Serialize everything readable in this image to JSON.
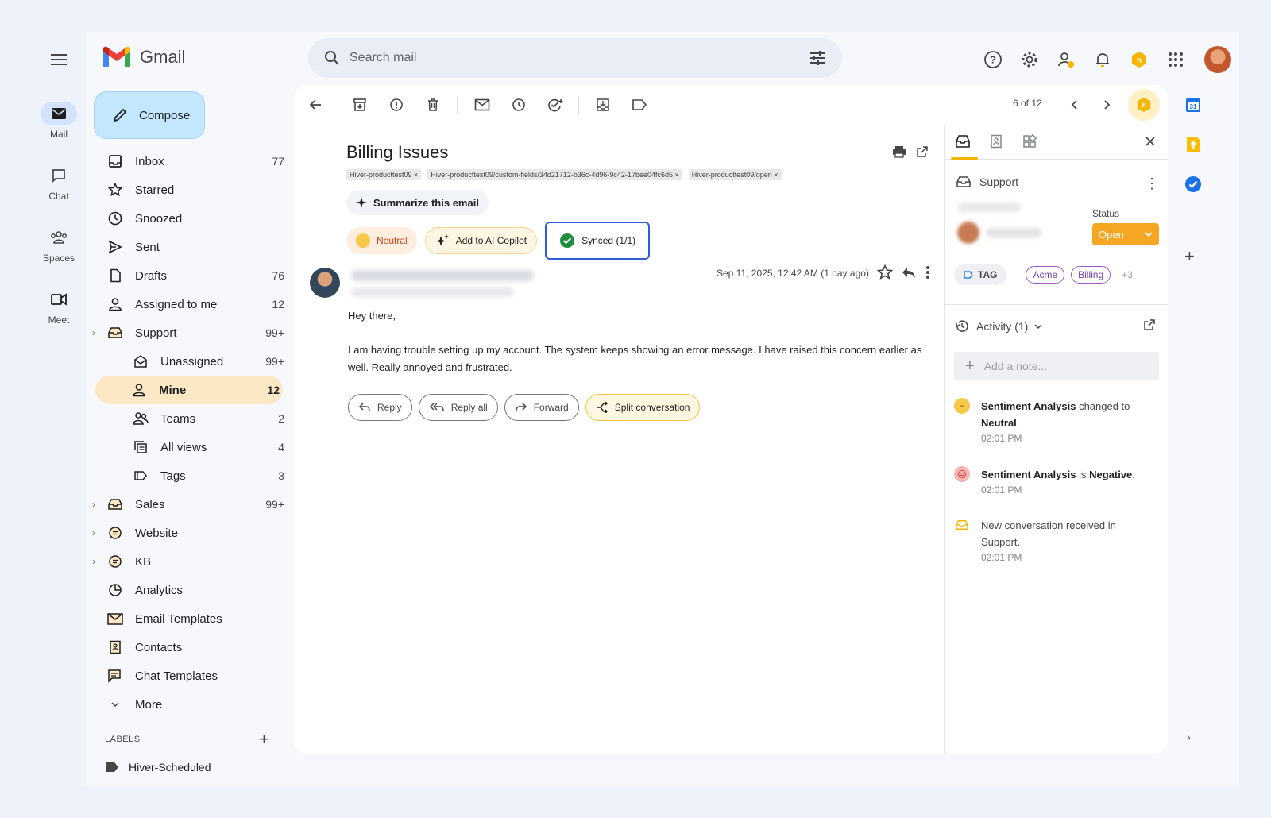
{
  "app": {
    "name": "Gmail"
  },
  "rail": [
    {
      "label": "Mail",
      "icon": "mail-icon",
      "active": true
    },
    {
      "label": "Chat",
      "icon": "chat-icon"
    },
    {
      "label": "Spaces",
      "icon": "spaces-icon"
    },
    {
      "label": "Meet",
      "icon": "meet-icon"
    }
  ],
  "search": {
    "placeholder": "Search mail"
  },
  "compose": {
    "label": "Compose"
  },
  "nav": [
    {
      "label": "Inbox",
      "count": "77"
    },
    {
      "label": "Starred",
      "count": ""
    },
    {
      "label": "Snoozed",
      "count": ""
    },
    {
      "label": "Sent",
      "count": ""
    },
    {
      "label": "Drafts",
      "count": "76"
    },
    {
      "label": "Assigned to me",
      "count": "12"
    },
    {
      "label": "Support",
      "count": "99+"
    },
    {
      "label": "Unassigned",
      "count": "99+"
    },
    {
      "label": "Mine",
      "count": "12"
    },
    {
      "label": "Teams",
      "count": "2"
    },
    {
      "label": "All views",
      "count": "4"
    },
    {
      "label": "Tags",
      "count": "3"
    },
    {
      "label": "Sales",
      "count": "99+"
    },
    {
      "label": "Website",
      "count": ""
    },
    {
      "label": "KB",
      "count": ""
    },
    {
      "label": "Analytics",
      "count": ""
    },
    {
      "label": "Email Templates",
      "count": ""
    },
    {
      "label": "Contacts",
      "count": ""
    },
    {
      "label": "Chat Templates",
      "count": ""
    },
    {
      "label": "More",
      "count": ""
    }
  ],
  "labels": {
    "header": "LABELS",
    "first": "Hiver-Scheduled"
  },
  "toolbar": {
    "pager": "6 of 12"
  },
  "email": {
    "subject": "Billing Issues",
    "tags": [
      "Hiver-producttest09 ×",
      "Hiver-producttest09/custom-fields/34d21712-b36c-4d96-9c42-17bee04fc6d5 ×",
      "Hiver-producttest09/open ×"
    ],
    "summarize": "Summarize this email",
    "sentiment": "Neutral",
    "copilot": "Add to AI Copilot",
    "synced": "Synced (1/1)",
    "date": "Sep 11, 2025, 12:42 AM (1 day ago)",
    "greeting": "Hey there,",
    "body": "I am having trouble setting up my account. The system keeps showing an error message. I have raised this concern earlier as well. Really annoyed and frustrated.",
    "actions": {
      "reply": "Reply",
      "reply_all": "Reply all",
      "forward": "Forward",
      "split": "Split conversation"
    }
  },
  "side": {
    "inbox": "Support",
    "status_label": "Status",
    "status_value": "Open",
    "tag_button": "TAG",
    "tags": [
      "Acme",
      "Billing"
    ],
    "more_tags": "+3",
    "activity": "Activity (1)",
    "note_placeholder": "Add a note...",
    "events": [
      {
        "bold1": "Sentiment Analysis",
        "mid": " changed to ",
        "bold2": "Neutral",
        "end": ".",
        "time": "02:01 PM"
      },
      {
        "bold1": "Sentiment Analysis",
        "mid": " is ",
        "bold2": "Negative",
        "end": ".",
        "time": "02:01 PM"
      },
      {
        "bold1": "",
        "mid": "New conversation received in Support.",
        "bold2": "",
        "end": "",
        "time": "02:01 PM"
      }
    ]
  },
  "colors": {
    "accent": "#f5a623",
    "compose_bg": "#c2e7ff",
    "active_nav": "#fde8c5",
    "synced_border": "#2f5bd6"
  }
}
